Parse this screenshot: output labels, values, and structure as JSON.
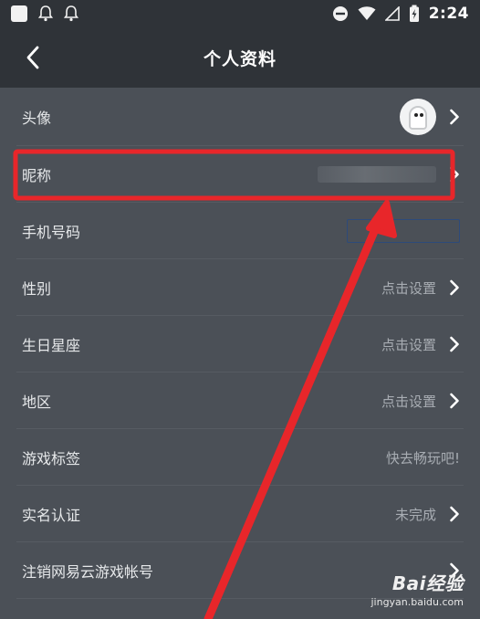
{
  "status_bar": {
    "time": "2:24",
    "icons": [
      "app-square-icon",
      "bell-icon",
      "bell-icon",
      "do-not-disturb-icon",
      "wifi-icon",
      "signal-icon",
      "battery-charging-icon"
    ]
  },
  "header": {
    "title": "个人资料",
    "back_icon": "chevron-left-icon"
  },
  "profile_rows": [
    {
      "label": "头像",
      "value": "",
      "type": "avatar",
      "chevron": true
    },
    {
      "label": "昵称",
      "value": "",
      "type": "blurred",
      "chevron": true
    },
    {
      "label": "手机号码",
      "value": "",
      "type": "input-box",
      "chevron": false
    },
    {
      "label": "性别",
      "value": "点击设置",
      "type": "text",
      "chevron": true
    },
    {
      "label": "生日星座",
      "value": "点击设置",
      "type": "text",
      "chevron": true
    },
    {
      "label": "地区",
      "value": "点击设置",
      "type": "text",
      "chevron": true
    },
    {
      "label": "游戏标签",
      "value": "快去畅玩吧!",
      "type": "text",
      "chevron": false
    },
    {
      "label": "实名认证",
      "value": "未完成",
      "type": "text",
      "chevron": true
    },
    {
      "label": "注销网易云游戏帐号",
      "value": "",
      "type": "text",
      "chevron": true
    }
  ],
  "annotation": {
    "highlight_color": "#e8262a",
    "highlighted_row": "昵称"
  },
  "watermark": {
    "logo": "Bai经验",
    "url": "jingyan.baidu.com"
  }
}
